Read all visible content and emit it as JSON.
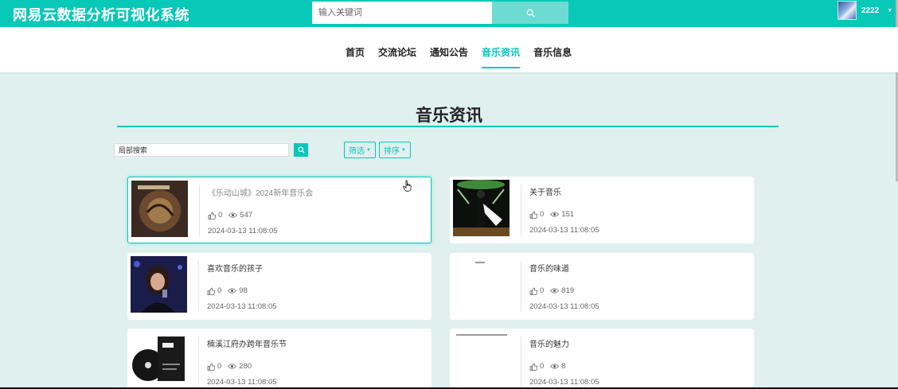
{
  "header": {
    "app_title": "网易云数据分析可视化系统",
    "search_placeholder": "输入关键词",
    "username": "2222"
  },
  "nav": {
    "items": [
      {
        "label": "首页"
      },
      {
        "label": "交流论坛"
      },
      {
        "label": "通知公告"
      },
      {
        "label": "音乐资讯",
        "active": true
      },
      {
        "label": "音乐信息"
      }
    ]
  },
  "main": {
    "page_title": "音乐资讯",
    "local_search_value": "局部搜索",
    "filter_label": "筛选",
    "sort_label": "排序"
  },
  "cards": [
    {
      "title": "《乐动山城》2024新年音乐会",
      "likes": "0",
      "views": "547",
      "date": "2024-03-13 11:08:05"
    },
    {
      "title": "关于音乐",
      "likes": "0",
      "views": "151",
      "date": "2024-03-13 11:08:05"
    },
    {
      "title": "喜欢音乐的孩子",
      "likes": "0",
      "views": "98",
      "date": "2024-03-13 11:08:05"
    },
    {
      "title": "音乐的味道",
      "likes": "0",
      "views": "819",
      "date": "2024-03-13 11:08:05"
    },
    {
      "title": "楠溪江府办跨年音乐节",
      "likes": "0",
      "views": "280",
      "date": "2024-03-13 11:08:05"
    },
    {
      "title": "音乐的魅力",
      "likes": "0",
      "views": "8",
      "date": "2024-03-13 11:08:05"
    }
  ],
  "colors": {
    "accent": "#08c8b8",
    "background": "#dff0ef"
  },
  "icons": {
    "search": "search-icon",
    "like": "thumbs-up-icon",
    "views": "eye-icon",
    "dropdown": "caret-down-icon"
  }
}
